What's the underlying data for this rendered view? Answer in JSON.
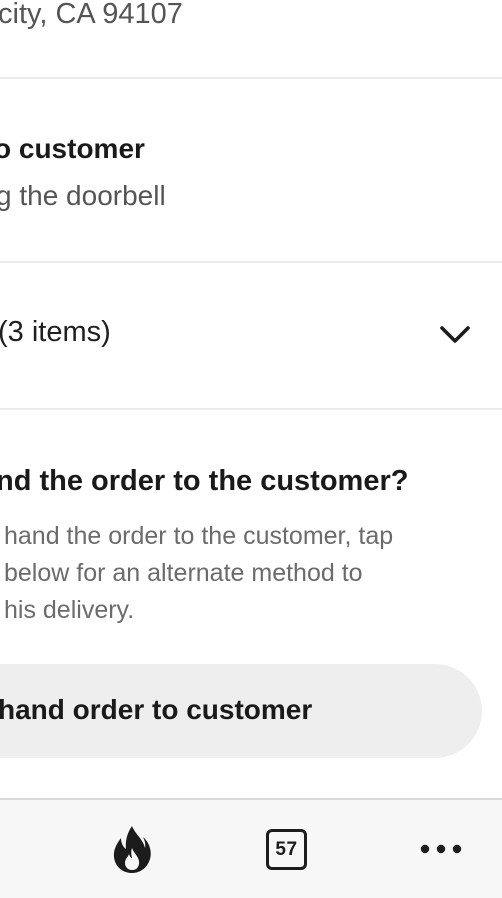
{
  "address": {
    "line": "city, CA 94107"
  },
  "dropoff_instructions": {
    "title": "o customer",
    "subtitle": "g the doorbell"
  },
  "order_items": {
    "label": "(3 items)",
    "expand_icon": "chevron-down-icon"
  },
  "handoff_question": {
    "title": "nd the order to the customer?",
    "body_lines": [
      "hand the order to the customer, tap",
      "below for an alternate method to",
      "his delivery."
    ]
  },
  "alternate_button": {
    "label": "hand order to customer"
  },
  "tab_bar": {
    "flame_icon": "flame-icon",
    "counter_badge": "57",
    "more_icon": "more-horizontal-icon"
  },
  "colors": {
    "text_primary": "#1a1a1a",
    "text_secondary": "#555555",
    "text_muted": "#6b6b6b",
    "divider": "#ececec",
    "button_bg": "#eeeeee",
    "tabbar_bg": "#f7f7f7"
  }
}
